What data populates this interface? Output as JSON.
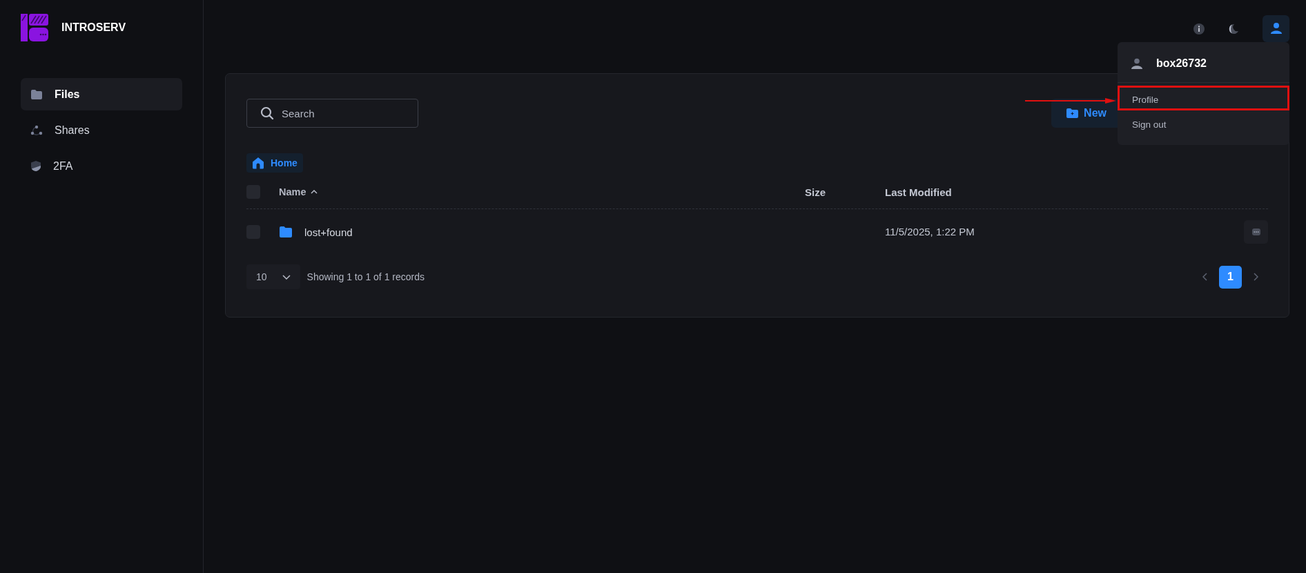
{
  "brand": {
    "name": "INTROSERV"
  },
  "sidebar": {
    "items": [
      {
        "label": "Files",
        "kind": "folder",
        "selected": true
      },
      {
        "label": "Shares",
        "kind": "share",
        "selected": false
      },
      {
        "label": "2FA",
        "kind": "shield",
        "selected": false
      }
    ]
  },
  "topbar": {
    "user_menu": {
      "expanded": true,
      "username": "box26732",
      "items": [
        {
          "label": "Profile",
          "highlighted": true
        },
        {
          "label": "Sign out",
          "highlighted": false
        }
      ]
    }
  },
  "search": {
    "placeholder": "Search"
  },
  "new_button": {
    "label": "New"
  },
  "breadcrumb": [
    {
      "label": "Home"
    }
  ],
  "table": {
    "all_checked": false,
    "columns": [
      {
        "label": "Name",
        "sorted": true
      },
      {
        "label": "Size",
        "sorted": false
      },
      {
        "label": "Last Modified",
        "sorted": false
      }
    ],
    "rows": [
      {
        "name": "lost+found",
        "modified": "11/5/2025, 1:22 PM",
        "checked": false
      }
    ]
  },
  "footer": {
    "page_size": "10",
    "summary": "Showing 1 to 1 of 1 records",
    "pages": [
      {
        "label": "1",
        "selected": true
      }
    ]
  }
}
